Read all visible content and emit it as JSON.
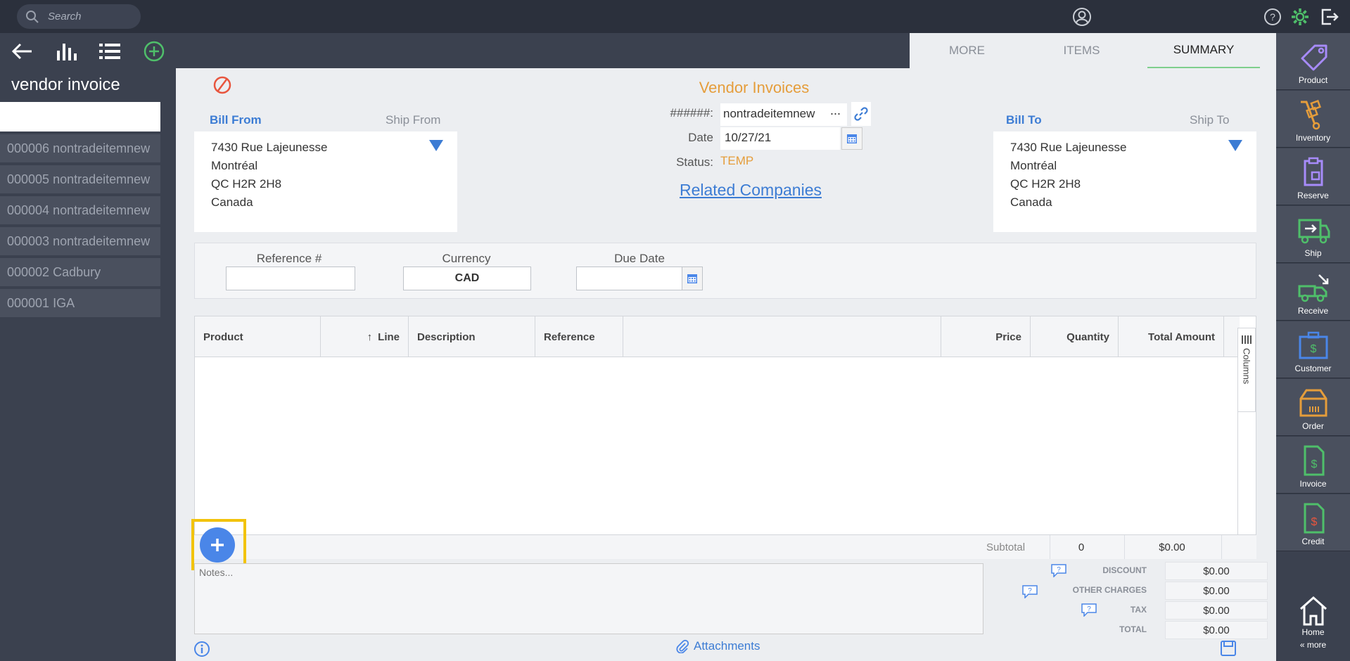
{
  "topbar": {
    "search_placeholder": "Search"
  },
  "leftpanel": {
    "title": "vendor invoice",
    "items": [
      {
        "label": "000006 nontradeitemnew"
      },
      {
        "label": "000005 nontradeitemnew"
      },
      {
        "label": "000004 nontradeitemnew"
      },
      {
        "label": "000003 nontradeitemnew"
      },
      {
        "label": "000002 Cadbury"
      },
      {
        "label": "000001 IGA"
      }
    ]
  },
  "tabs": [
    {
      "label": "MORE"
    },
    {
      "label": "ITEMS"
    },
    {
      "label": "SUMMARY",
      "active": true
    }
  ],
  "document": {
    "title": "Vendor Invoices",
    "number_label": "######:",
    "number_value": "nontradeitemnew",
    "number_more": "...",
    "date_label": "Date",
    "date_value": "10/27/21",
    "status_label": "Status:",
    "status_value": "TEMP",
    "related_link": "Related Companies"
  },
  "bill_from": {
    "label": "Bill From",
    "alt_label": "Ship From",
    "lines": [
      "7430 Rue Lajeunesse",
      "Montréal",
      "QC H2R 2H8",
      "Canada"
    ]
  },
  "bill_to": {
    "label": "Bill To",
    "alt_label": "Ship To",
    "lines": [
      "7430 Rue Lajeunesse",
      "Montréal",
      "QC H2R 2H8",
      "Canada"
    ]
  },
  "references": {
    "reference_label": "Reference #",
    "reference_value": "",
    "currency_label": "Currency",
    "currency_value": "CAD",
    "due_label": "Due Date",
    "due_value": ""
  },
  "grid": {
    "columns": {
      "product": "Product",
      "line": "Line",
      "description": "Description",
      "reference": "Reference",
      "price": "Price",
      "quantity": "Quantity",
      "total": "Total Amount"
    },
    "columns_tab": "Columns"
  },
  "totals": {
    "subtotal_label": "Subtotal",
    "subtotal_qty": "0",
    "subtotal_amount": "$0.00",
    "discount_label": "DISCOUNT",
    "discount_value": "$0.00",
    "other_label": "OTHER CHARGES",
    "other_value": "$0.00",
    "tax_label": "TAX",
    "tax_value": "$0.00",
    "total_label": "TOTAL",
    "total_value": "$0.00"
  },
  "notes": {
    "placeholder": "Notes..."
  },
  "footer": {
    "attachments": "Attachments"
  },
  "rightnav": {
    "items": [
      {
        "label": "Product",
        "icon": "tag-icon"
      },
      {
        "label": "Inventory",
        "icon": "hand-truck-icon"
      },
      {
        "label": "Reserve",
        "icon": "clipboard-icon"
      },
      {
        "label": "Ship",
        "icon": "truck-ship-icon"
      },
      {
        "label": "Receive",
        "icon": "truck-receive-icon"
      },
      {
        "label": "Customer",
        "icon": "briefcase-icon"
      },
      {
        "label": "Order",
        "icon": "box-icon"
      },
      {
        "label": "Invoice",
        "icon": "invoice-doc-icon"
      },
      {
        "label": "Credit",
        "icon": "credit-doc-icon"
      }
    ],
    "home_label": "Home",
    "more_label": "« more"
  },
  "colors": {
    "accent_blue": "#3c7cd4",
    "title_orange": "#e59d3b",
    "tab_underline": "#7ecf8c",
    "highlight_yellow": "#f2c30b"
  }
}
